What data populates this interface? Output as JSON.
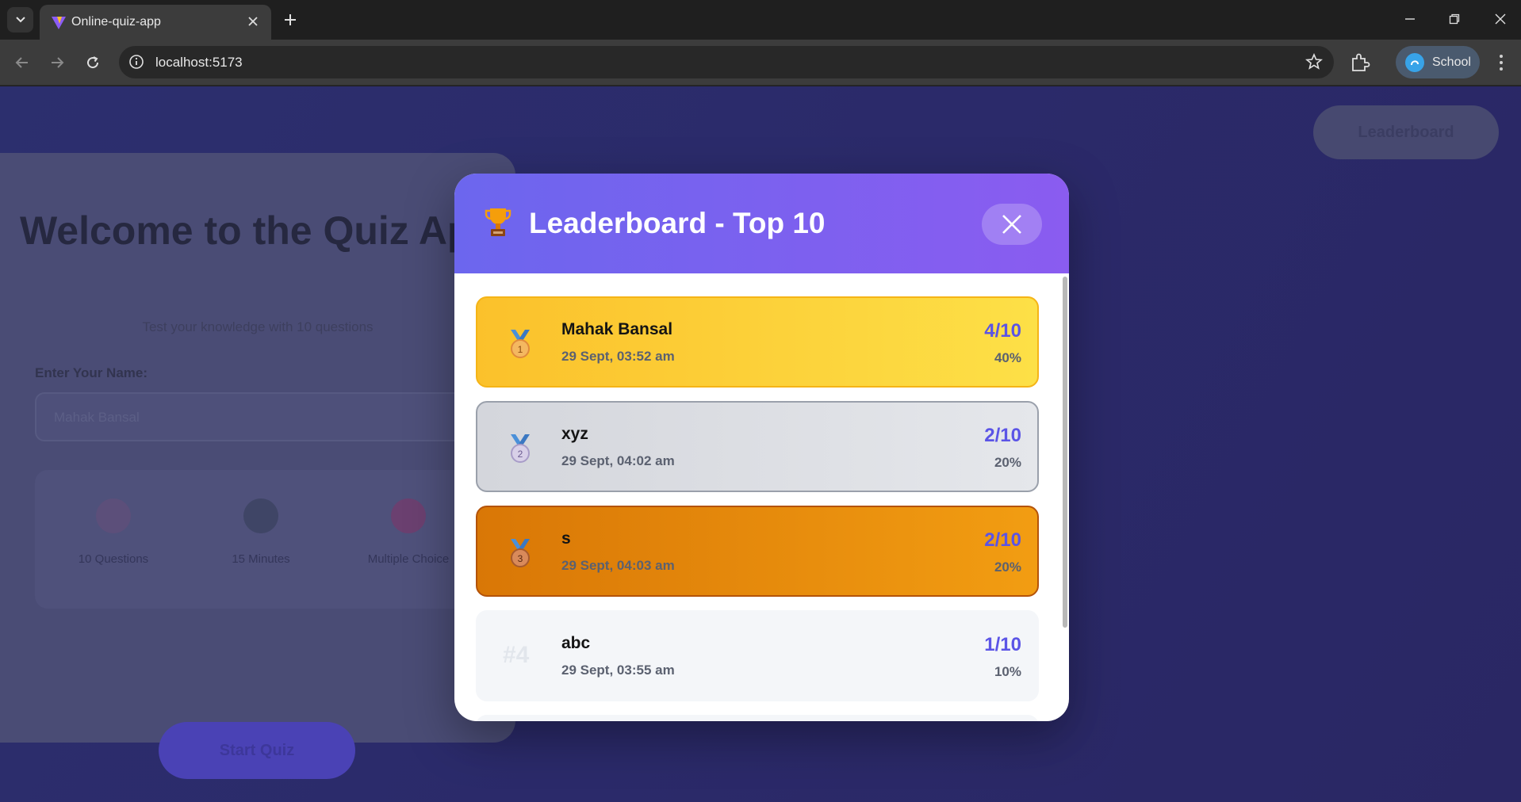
{
  "browser": {
    "tab_title": "Online-quiz-app",
    "url": "localhost:5173",
    "profile_label": "School"
  },
  "background": {
    "welcome_title": "Welcome to the Quiz App",
    "welcome_subtitle": "Test your knowledge with 10 questions",
    "name_label": "Enter Your Name:",
    "name_placeholder": "Mahak Bansal",
    "features": [
      {
        "label": "10 Questions"
      },
      {
        "label": "15 Minutes"
      },
      {
        "label": "Multiple Choice"
      }
    ],
    "start_button": "Start Quiz",
    "leaderboard_button": "Leaderboard"
  },
  "modal": {
    "title": "Leaderboard - Top 10",
    "entries": [
      {
        "rank": "1",
        "name": "Mahak Bansal",
        "date": "29 Sept, 03:52 am",
        "score": "4/10",
        "percent": "40%"
      },
      {
        "rank": "2",
        "name": "xyz",
        "date": "29 Sept, 04:02 am",
        "score": "2/10",
        "percent": "20%"
      },
      {
        "rank": "3",
        "name": "s",
        "date": "29 Sept, 04:03 am",
        "score": "2/10",
        "percent": "20%"
      },
      {
        "rank": "#4",
        "name": "abc",
        "date": "29 Sept, 03:55 am",
        "score": "1/10",
        "percent": "10%"
      }
    ]
  },
  "colors": {
    "gold": "#fbc12b",
    "silver": "#d4d6dc",
    "bronze": "#d97706",
    "score_accent": "#5b54e6",
    "header_start": "#6c66ee",
    "header_end": "#8a5cf0"
  }
}
